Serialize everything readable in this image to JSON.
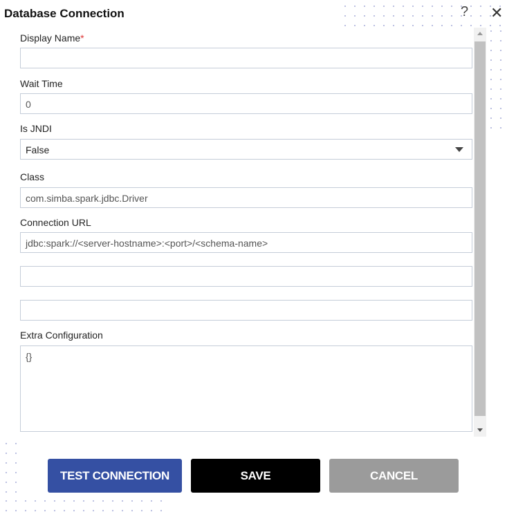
{
  "dialog": {
    "title": "Database Connection",
    "help_icon": "?",
    "close_icon": "✕"
  },
  "fields": {
    "display_name": {
      "label": "Display Name",
      "required_mark": "*",
      "value": ""
    },
    "wait_time": {
      "label": "Wait Time",
      "value": "0"
    },
    "is_jndi": {
      "label": "Is JNDI",
      "value": "False"
    },
    "class": {
      "label": "Class",
      "value": "com.simba.spark.jdbc.Driver"
    },
    "connection_url": {
      "label": "Connection URL",
      "value": "jdbc:spark://<server-hostname>:<port>/<schema-name>"
    },
    "username": {
      "value": ""
    },
    "password": {
      "value": ""
    },
    "extra_configuration": {
      "label": "Extra Configuration",
      "value": "{}"
    }
  },
  "buttons": {
    "test": "TEST CONNECTION",
    "save": "SAVE",
    "cancel": "CANCEL"
  },
  "colors": {
    "test": "#3550a3",
    "save": "#000000",
    "cancel": "#9b9b9b"
  }
}
